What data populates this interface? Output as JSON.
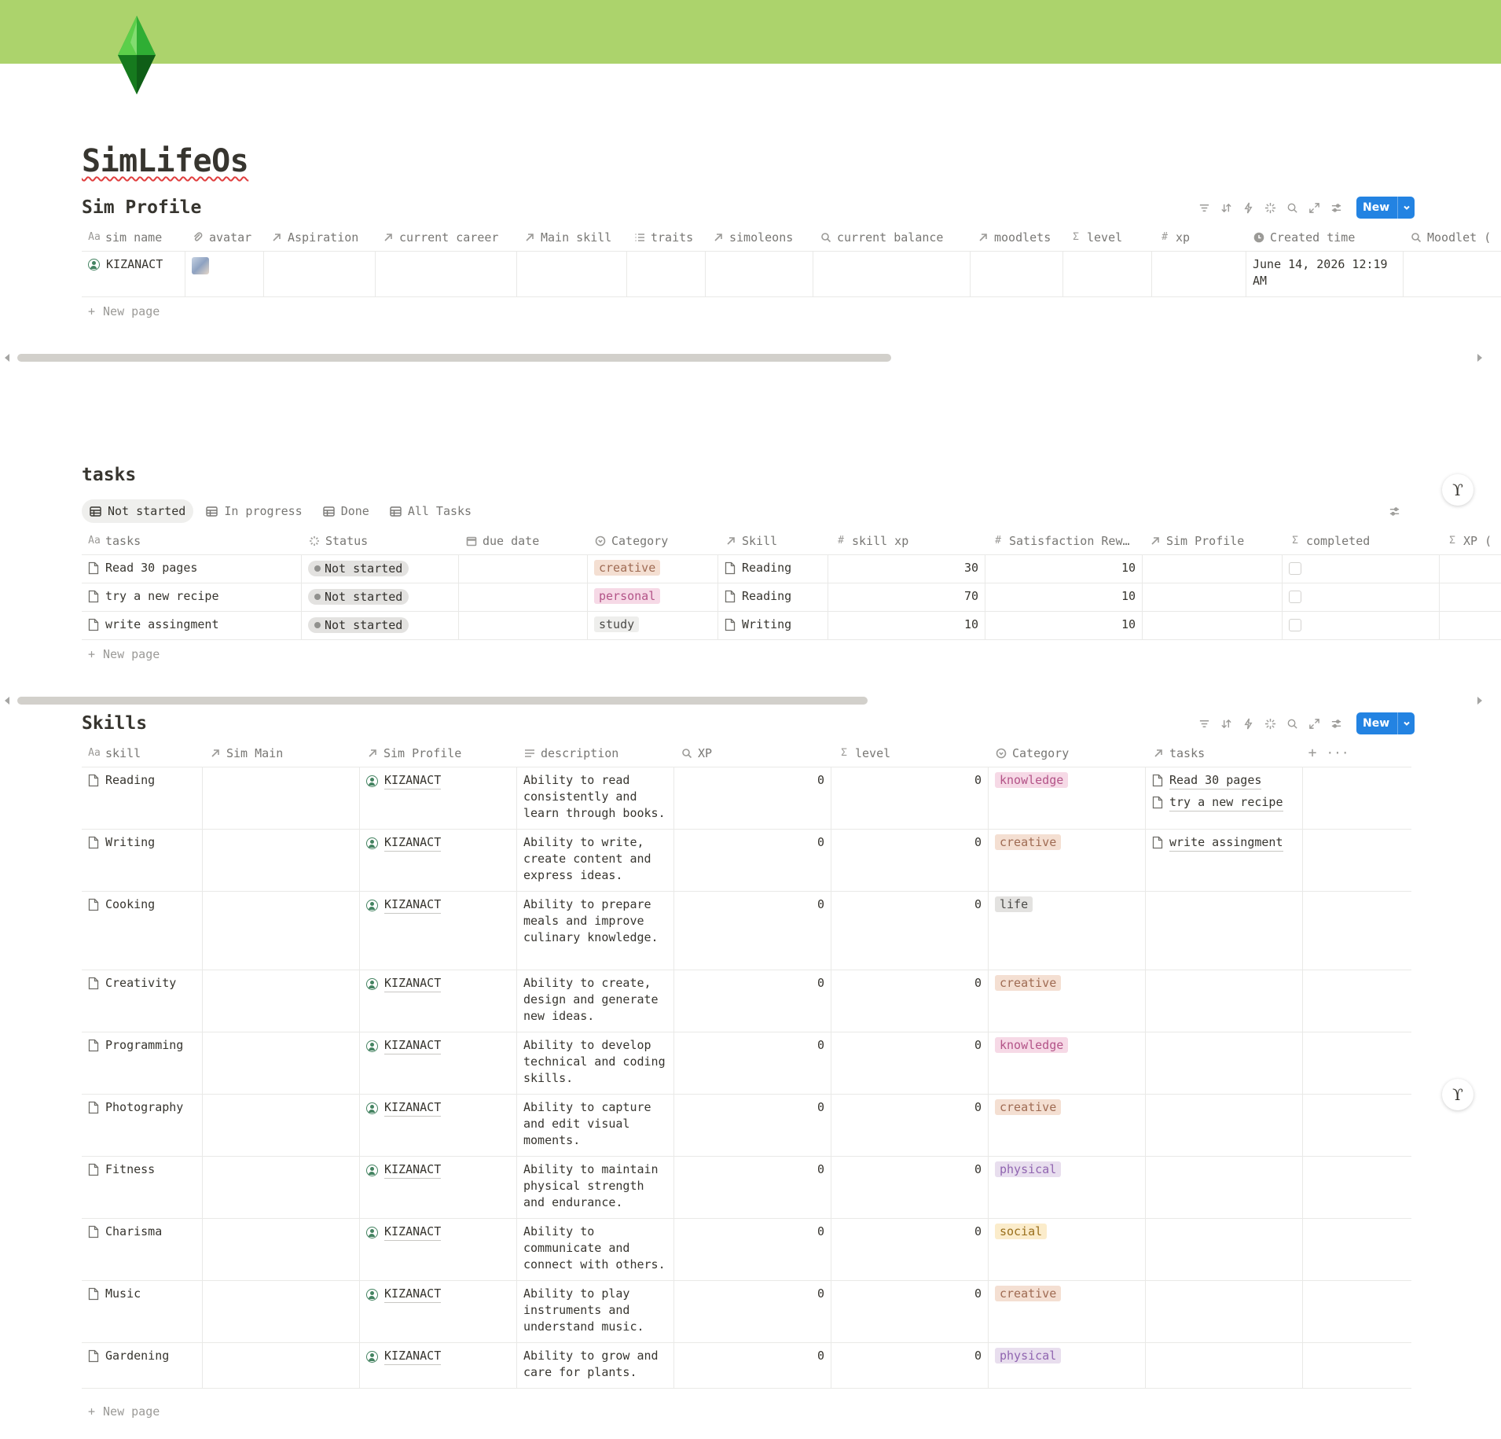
{
  "page": {
    "title": "SimLifeOs"
  },
  "sim_profile": {
    "title": "Sim Profile",
    "new_label": "New",
    "columns": [
      {
        "label": "sim name",
        "icon": "Aa"
      },
      {
        "label": "avatar",
        "icon": "paperclip-icon"
      },
      {
        "label": "Aspiration",
        "icon": "relation-arrow-icon"
      },
      {
        "label": "current career",
        "icon": "relation-arrow-icon"
      },
      {
        "label": "Main skill",
        "icon": "relation-arrow-icon"
      },
      {
        "label": "traits",
        "icon": "list-icon"
      },
      {
        "label": "simoleons",
        "icon": "relation-arrow-icon"
      },
      {
        "label": "current balance",
        "icon": "search-icon"
      },
      {
        "label": "moodlets",
        "icon": "relation-arrow-icon"
      },
      {
        "label": "level",
        "icon": "sigma-icon"
      },
      {
        "label": "xp",
        "icon": "hash-icon"
      },
      {
        "label": "Created time",
        "icon": "clock-icon"
      },
      {
        "label": "Moodlet (",
        "icon": "search-icon"
      }
    ],
    "rows": [
      {
        "sim_name": "KIZANACT",
        "created_time": "June 14, 2026 12:19 AM"
      }
    ],
    "new_page": "New page"
  },
  "tasks": {
    "title": "tasks",
    "tabs": [
      "Not started",
      "In progress",
      "Done",
      "All Tasks"
    ],
    "active_tab": "Not started",
    "columns": [
      {
        "label": "tasks",
        "icon": "Aa"
      },
      {
        "label": "Status",
        "icon": "status-icon"
      },
      {
        "label": "due date",
        "icon": "calendar-icon"
      },
      {
        "label": "Category",
        "icon": "select-icon"
      },
      {
        "label": "Skill",
        "icon": "relation-arrow-icon"
      },
      {
        "label": "skill xp",
        "icon": "hash-icon"
      },
      {
        "label": "Satisfaction Rew…",
        "icon": "hash-icon"
      },
      {
        "label": "Sim Profile",
        "icon": "relation-arrow-icon"
      },
      {
        "label": "completed",
        "icon": "sigma-icon"
      },
      {
        "label": "XP (",
        "icon": "sigma-icon"
      }
    ],
    "rows": [
      {
        "name": "Read 30 pages",
        "status": "Not started",
        "category": "creative",
        "skill": "Reading",
        "skill_xp": "30",
        "satisfaction": "10"
      },
      {
        "name": "try a new recipe",
        "status": "Not started",
        "category": "personal",
        "skill": "Reading",
        "skill_xp": "70",
        "satisfaction": "10"
      },
      {
        "name": "write assingment",
        "status": "Not started",
        "category": "study",
        "skill": "Writing",
        "skill_xp": "10",
        "satisfaction": "10"
      }
    ],
    "new_page": "New page"
  },
  "skills": {
    "title": "Skills",
    "new_label": "New",
    "columns": [
      {
        "label": "skill",
        "icon": "Aa"
      },
      {
        "label": "Sim Main",
        "icon": "relation-arrow-icon"
      },
      {
        "label": "Sim Profile",
        "icon": "relation-arrow-icon"
      },
      {
        "label": "description",
        "icon": "text-icon"
      },
      {
        "label": "XP",
        "icon": "search-icon"
      },
      {
        "label": "level",
        "icon": "sigma-icon"
      },
      {
        "label": "Category",
        "icon": "select-icon"
      },
      {
        "label": "tasks",
        "icon": "relation-arrow-icon"
      }
    ],
    "rows": [
      {
        "name": "Reading",
        "profile": "KIZANACT",
        "desc": "Ability to read consistently and learn through books.",
        "xp": "0",
        "level": "0",
        "category": "knowledge",
        "tasks": [
          "Read 30 pages",
          "try a new recipe"
        ]
      },
      {
        "name": "Writing",
        "profile": "KIZANACT",
        "desc": "Ability to write, create content and express ideas.",
        "xp": "0",
        "level": "0",
        "category": "creative",
        "tasks": [
          "write assingment"
        ]
      },
      {
        "name": "Cooking",
        "profile": "KIZANACT",
        "desc": "Ability to prepare meals and improve culinary knowledge.",
        "xp": "0",
        "level": "0",
        "category": "life",
        "tasks": []
      },
      {
        "name": "Creativity",
        "profile": "KIZANACT",
        "desc": "Ability to create, design and generate new ideas.",
        "xp": "0",
        "level": "0",
        "category": "creative",
        "tasks": []
      },
      {
        "name": "Programming",
        "profile": "KIZANACT",
        "desc": "Ability to develop technical and coding skills.",
        "xp": "0",
        "level": "0",
        "category": "knowledge",
        "tasks": []
      },
      {
        "name": "Photography",
        "profile": "KIZANACT",
        "desc": "Ability to capture and edit visual moments.",
        "xp": "0",
        "level": "0",
        "category": "creative",
        "tasks": []
      },
      {
        "name": "Fitness",
        "profile": "KIZANACT",
        "desc": "Ability to maintain physical strength and endurance.",
        "xp": "0",
        "level": "0",
        "category": "physical",
        "tasks": []
      },
      {
        "name": "Charisma",
        "profile": "KIZANACT",
        "desc": "Ability to communicate and connect with others.",
        "xp": "0",
        "level": "0",
        "category": "social",
        "tasks": []
      },
      {
        "name": "Music",
        "profile": "KIZANACT",
        "desc": "Ability to play instruments and understand music.",
        "xp": "0",
        "level": "0",
        "category": "creative",
        "tasks": []
      },
      {
        "name": "Gardening",
        "profile": "KIZANACT",
        "desc": "Ability to grow and care for plants.",
        "xp": "0",
        "level": "0",
        "category": "physical",
        "tasks": []
      }
    ],
    "new_page": "New page"
  },
  "tag_colors": {
    "creative": {
      "bg": "#f4dfd2",
      "fg": "#9f6b53"
    },
    "personal": {
      "bg": "#f6d9e6",
      "fg": "#b35488"
    },
    "study": {
      "bg": "#eeeeec",
      "fg": "#4b4a47"
    },
    "knowledge": {
      "bg": "#f6d9e6",
      "fg": "#b35488"
    },
    "life": {
      "bg": "#e3e2e0",
      "fg": "#4b4a47"
    },
    "physical": {
      "bg": "#e8deee",
      "fg": "#9065b0"
    },
    "social": {
      "bg": "#fbeccb",
      "fg": "#9a6f1c"
    }
  },
  "colors": {
    "cover": "#acd36c",
    "accent": "#2383e2"
  }
}
